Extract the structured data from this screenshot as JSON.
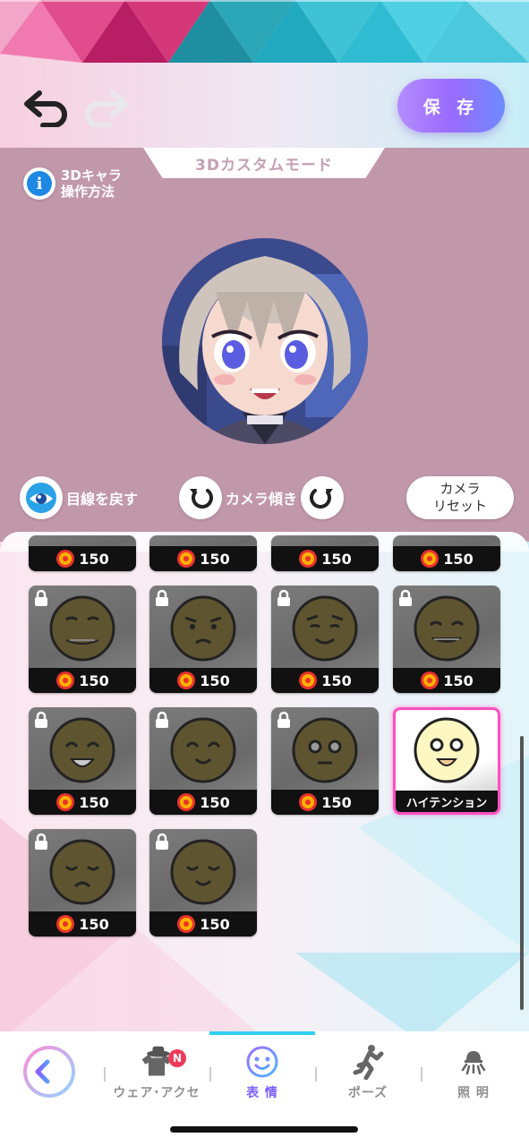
{
  "header": {
    "save_label": "保 存"
  },
  "preview": {
    "mode_title": "3Dカスタムモード",
    "help_label": "3Dキャラ\n操作方法",
    "gaze_label": "目線を戻す",
    "tilt_label": "カメラ傾き",
    "reset_label": "カメラ\nリセット"
  },
  "grid": {
    "top_row_prices": [
      "150",
      "150",
      "150",
      "150"
    ],
    "rows": [
      [
        {
          "expression": "smile-teeth",
          "price": "150",
          "locked": true
        },
        {
          "expression": "worried",
          "price": "150",
          "locked": true
        },
        {
          "expression": "smirk",
          "price": "150",
          "locked": true
        },
        {
          "expression": "grin-closed-eyes",
          "price": "150",
          "locked": true
        }
      ],
      [
        {
          "expression": "happy-open",
          "price": "150",
          "locked": true
        },
        {
          "expression": "content-smile",
          "price": "150",
          "locked": true
        },
        {
          "expression": "wide-eyed",
          "price": "150",
          "locked": true
        },
        {
          "expression": "high-tension",
          "name": "ハイテンション",
          "locked": false,
          "selected": true
        }
      ],
      [
        {
          "expression": "sad-closed-eyes",
          "price": "150",
          "locked": true
        },
        {
          "expression": "calm-smile",
          "price": "150",
          "locked": true
        }
      ]
    ]
  },
  "nav": {
    "items": [
      {
        "label": "ウェア･アクセ",
        "icon": "clothing-hat-icon",
        "badge": "N"
      },
      {
        "label": "表 情",
        "icon": "smiley-face-icon",
        "active": true
      },
      {
        "label": "ポーズ",
        "icon": "pose-figure-icon"
      },
      {
        "label": "照 明",
        "icon": "lamp-icon"
      }
    ]
  },
  "colors": {
    "accent": "#7b5cff",
    "preview_bg": "#c197aa",
    "selected_border": "#ff4fc0"
  }
}
